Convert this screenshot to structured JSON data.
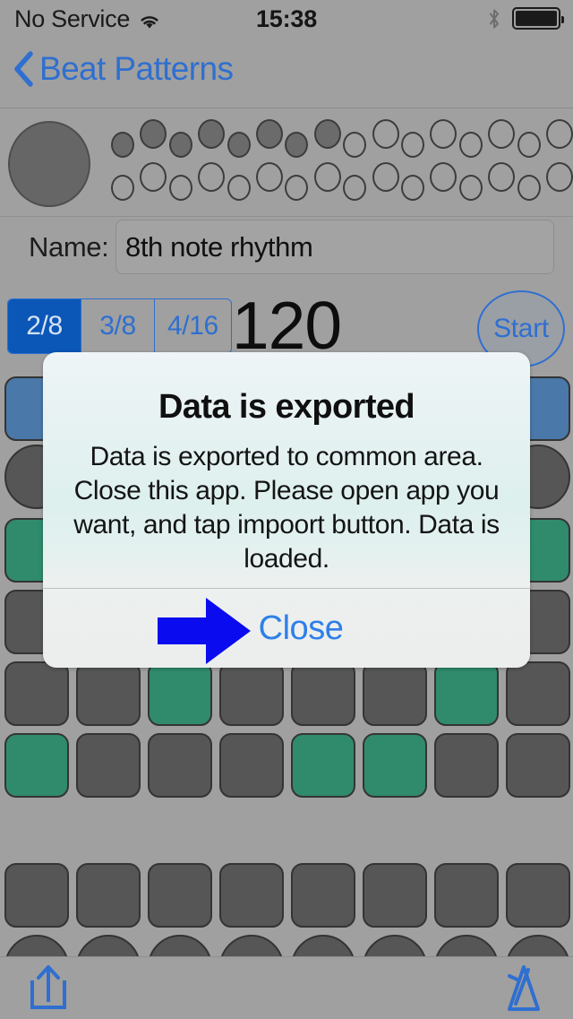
{
  "status_bar": {
    "carrier": "No Service",
    "wifi_icon": "wifi-icon",
    "time": "15:38",
    "bluetooth_icon": "bluetooth-icon",
    "battery_icon": "battery-full-icon"
  },
  "nav_bar": {
    "back_icon": "chevron-left-icon",
    "back_title": "Beat Patterns"
  },
  "indicator_strip": {
    "big_circle": "beat-indicator-circle",
    "rows": [
      {
        "name": "beat-dots-row-top",
        "dots": [
          {
            "on": true
          },
          {
            "on": true
          },
          {
            "on": true
          },
          {
            "on": true
          },
          {
            "on": true
          },
          {
            "on": true
          },
          {
            "on": true
          },
          {
            "on": true
          },
          {
            "on": false
          },
          {
            "on": false
          },
          {
            "on": false
          },
          {
            "on": false
          },
          {
            "on": false
          },
          {
            "on": false
          },
          {
            "on": false
          },
          {
            "on": false
          }
        ]
      },
      {
        "name": "beat-dots-row-bottom",
        "dots": [
          {
            "on": false
          },
          {
            "on": false
          },
          {
            "on": false
          },
          {
            "on": false
          },
          {
            "on": false
          },
          {
            "on": false
          },
          {
            "on": false
          },
          {
            "on": false
          },
          {
            "on": false
          },
          {
            "on": false
          },
          {
            "on": false
          },
          {
            "on": false
          },
          {
            "on": false
          },
          {
            "on": false
          },
          {
            "on": false
          },
          {
            "on": false
          }
        ]
      }
    ]
  },
  "name_row": {
    "label": "Name:",
    "value": "8th note rhythm",
    "placeholder": "Name"
  },
  "controls": {
    "segments": [
      {
        "label": "2/8",
        "selected": true
      },
      {
        "label": "3/8",
        "selected": false
      },
      {
        "label": "4/16",
        "selected": false
      }
    ],
    "bpm": "120",
    "start_label": "Start"
  },
  "pad_grid": {
    "columns": 8,
    "rows": [
      {
        "name": "pad-row-1",
        "shape": "square",
        "cells": [
          "blue",
          "blue",
          "blue",
          "blue",
          "blue",
          "blue",
          "blue",
          "blue"
        ]
      },
      {
        "name": "pad-row-2",
        "shape": "circle",
        "cells": [
          "grey",
          "grey",
          "grey",
          "grey",
          "grey",
          "grey",
          "grey",
          "grey"
        ]
      },
      {
        "name": "pad-row-3",
        "shape": "square",
        "cells": [
          "green",
          "green",
          "green",
          "green",
          "green",
          "green",
          "green",
          "green"
        ]
      },
      {
        "name": "pad-row-4",
        "shape": "square",
        "cells": [
          "grey",
          "grey",
          "grey",
          "grey",
          "grey",
          "grey",
          "grey",
          "grey"
        ]
      },
      {
        "name": "pad-row-5",
        "shape": "square",
        "cells": [
          "grey",
          "grey",
          "green",
          "grey",
          "grey",
          "grey",
          "green",
          "grey"
        ]
      },
      {
        "name": "pad-row-6",
        "shape": "square",
        "cells": [
          "green",
          "grey",
          "grey",
          "grey",
          "green",
          "green",
          "grey",
          "grey"
        ]
      },
      {
        "name": "pad-row-7",
        "shape": "square",
        "cells": [
          "grey",
          "grey",
          "grey",
          "grey",
          "grey",
          "grey",
          "grey",
          "grey"
        ]
      },
      {
        "name": "pad-row-8",
        "shape": "circle",
        "cells": [
          "grey",
          "grey",
          "grey",
          "grey",
          "grey",
          "grey",
          "grey",
          "grey"
        ]
      }
    ],
    "colors": {
      "grey": "#565656",
      "green": "#2f8b6c",
      "blue": "#4a78a8",
      "border": "#343434"
    }
  },
  "alert": {
    "title": "Data is exported",
    "message": "Data is exported to common area. Close this app. Please open app you want, and tap impoort button. Data is loaded.",
    "close_label": "Close",
    "arrow_icon": "arrow-right-icon",
    "arrow_color": "#0b0bef",
    "close_color": "#2e7fe8"
  },
  "toolbar": {
    "share_icon": "share-upload-icon",
    "metronome_icon": "metronome-icon",
    "tint": "#2f6fd0"
  }
}
